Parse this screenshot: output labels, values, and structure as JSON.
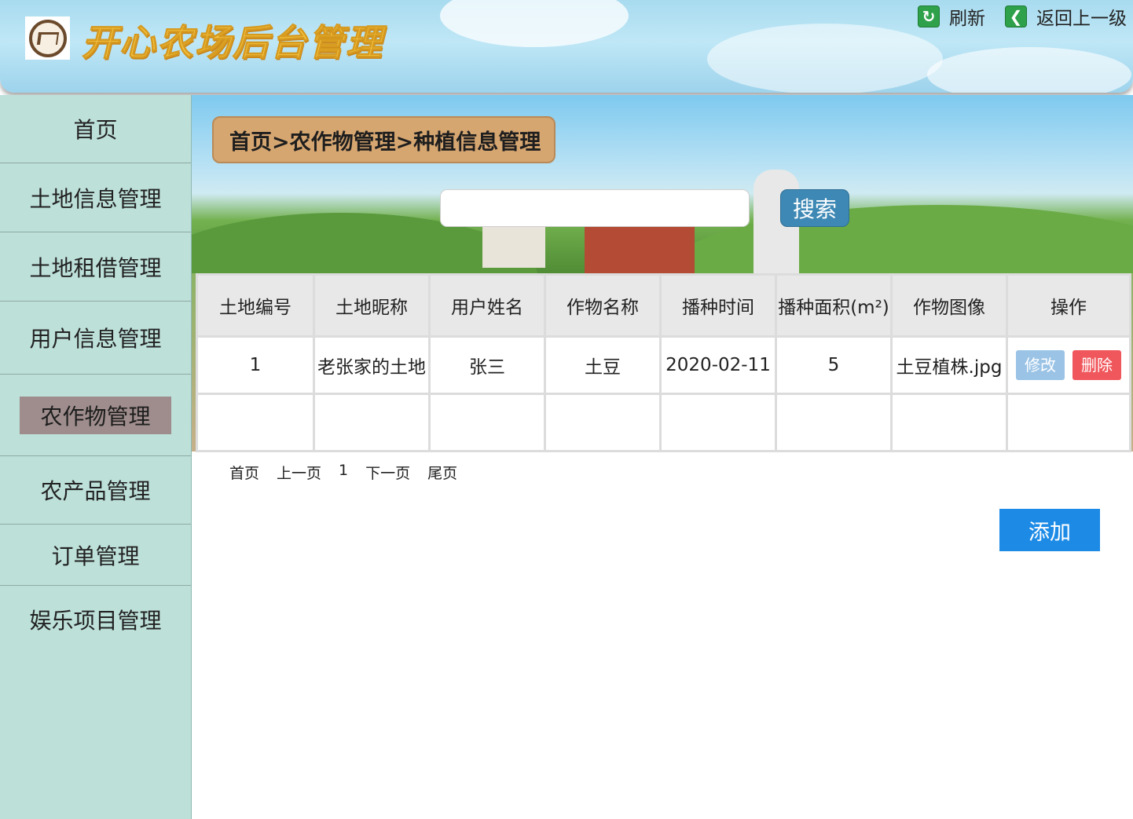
{
  "header": {
    "title": "开心农场后台管理",
    "refresh_label": "刷新",
    "back_label": "返回上一级"
  },
  "sidebar": {
    "items": [
      {
        "label": "首页"
      },
      {
        "label": "土地信息管理"
      },
      {
        "label": "土地租借管理"
      },
      {
        "label": "用户信息管理"
      },
      {
        "label": "农作物管理",
        "active": true
      },
      {
        "label": "农产品管理"
      },
      {
        "label": "订单管理"
      },
      {
        "label": "娱乐项目管理"
      }
    ]
  },
  "main": {
    "breadcrumb": "首页>农作物管理>种植信息管理",
    "search": {
      "value": "",
      "placeholder": "",
      "button_label": "搜索"
    },
    "table": {
      "headers": [
        "土地编号",
        "土地昵称",
        "用户姓名",
        "作物名称",
        "播种时间",
        "播种面积(m²)",
        "作物图像",
        "操作"
      ],
      "rows": [
        [
          "1",
          "老张家的土地",
          "张三",
          "土豆",
          "2020-02-11",
          "5",
          "土豆植株.jpg"
        ]
      ],
      "edit_label": "修改",
      "delete_label": "删除"
    },
    "pager": {
      "first": "首页",
      "prev": "上一页",
      "current": "1",
      "next": "下一页",
      "last": "尾页"
    },
    "add_label": "添加"
  },
  "colors": {
    "sidebar_bg": "#bde0d9",
    "active_nav": "#9f8d8d",
    "edit_button": "#9ac3e6",
    "delete_button": "#f0575c",
    "add_button": "#1d8be6",
    "title": "#f4c443"
  },
  "icons": {
    "refresh": "refresh-icon",
    "back": "back-arrow-icon"
  }
}
